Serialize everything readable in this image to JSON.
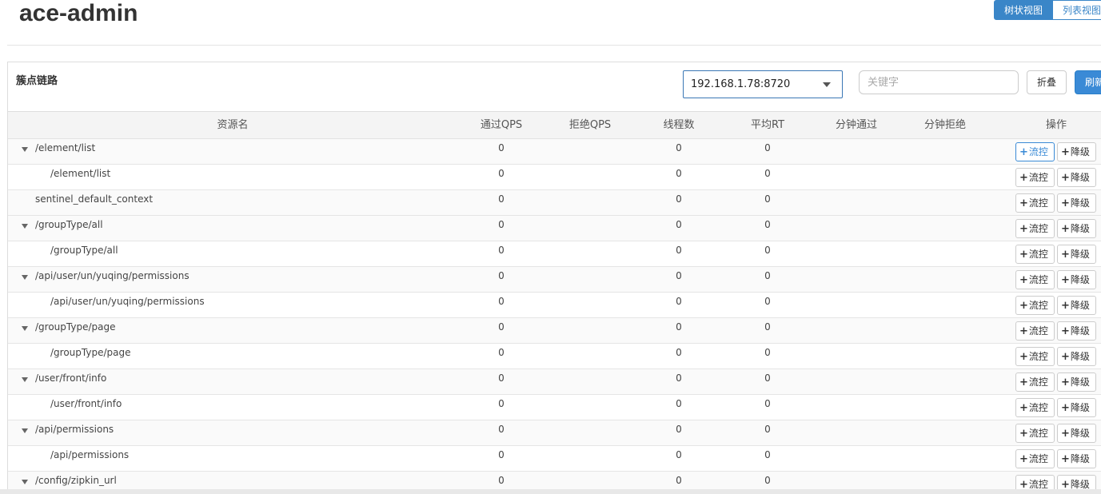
{
  "header": {
    "title": "ace-admin",
    "view_toggle": {
      "tree_label": "树状视图",
      "list_label": "列表视图"
    }
  },
  "panel": {
    "title": "簇点链路",
    "machine_select_value": "192.168.1.78:8720",
    "keyword_placeholder": "关键字",
    "collapse_label": "折叠",
    "refresh_label": "刷新"
  },
  "table": {
    "columns": [
      "资源名",
      "通过QPS",
      "拒绝QPS",
      "线程数",
      "平均RT",
      "分钟通过",
      "分钟拒绝",
      "操作"
    ],
    "flow_label": "流控",
    "degrade_label": "降级",
    "rows": [
      {
        "name": "/element/list",
        "level": 0,
        "has_toggle": true,
        "pass_qps": "0",
        "threads": "0",
        "avg_rt": "0"
      },
      {
        "name": "/element/list",
        "level": 1,
        "has_toggle": false,
        "pass_qps": "0",
        "threads": "0",
        "avg_rt": "0"
      },
      {
        "name": "sentinel_default_context",
        "level": 0,
        "has_toggle": false,
        "pass_qps": "0",
        "threads": "0",
        "avg_rt": "0"
      },
      {
        "name": "/groupType/all",
        "level": 0,
        "has_toggle": true,
        "pass_qps": "0",
        "threads": "0",
        "avg_rt": "0"
      },
      {
        "name": "/groupType/all",
        "level": 1,
        "has_toggle": false,
        "pass_qps": "0",
        "threads": "0",
        "avg_rt": "0"
      },
      {
        "name": "/api/user/un/yuqing/permissions",
        "level": 0,
        "has_toggle": true,
        "pass_qps": "0",
        "threads": "0",
        "avg_rt": "0"
      },
      {
        "name": "/api/user/un/yuqing/permissions",
        "level": 1,
        "has_toggle": false,
        "pass_qps": "0",
        "threads": "0",
        "avg_rt": "0"
      },
      {
        "name": "/groupType/page",
        "level": 0,
        "has_toggle": true,
        "pass_qps": "0",
        "threads": "0",
        "avg_rt": "0"
      },
      {
        "name": "/groupType/page",
        "level": 1,
        "has_toggle": false,
        "pass_qps": "0",
        "threads": "0",
        "avg_rt": "0"
      },
      {
        "name": "/user/front/info",
        "level": 0,
        "has_toggle": true,
        "pass_qps": "0",
        "threads": "0",
        "avg_rt": "0"
      },
      {
        "name": "/user/front/info",
        "level": 1,
        "has_toggle": false,
        "pass_qps": "0",
        "threads": "0",
        "avg_rt": "0"
      },
      {
        "name": "/api/permissions",
        "level": 0,
        "has_toggle": true,
        "pass_qps": "0",
        "threads": "0",
        "avg_rt": "0"
      },
      {
        "name": "/api/permissions",
        "level": 1,
        "has_toggle": false,
        "pass_qps": "0",
        "threads": "0",
        "avg_rt": "0"
      },
      {
        "name": "/config/zipkin_url",
        "level": 0,
        "has_toggle": true,
        "pass_qps": "0",
        "threads": "0",
        "avg_rt": "0"
      }
    ]
  },
  "colors": {
    "primary": "#3a8ad6",
    "border": "#dddddd"
  }
}
